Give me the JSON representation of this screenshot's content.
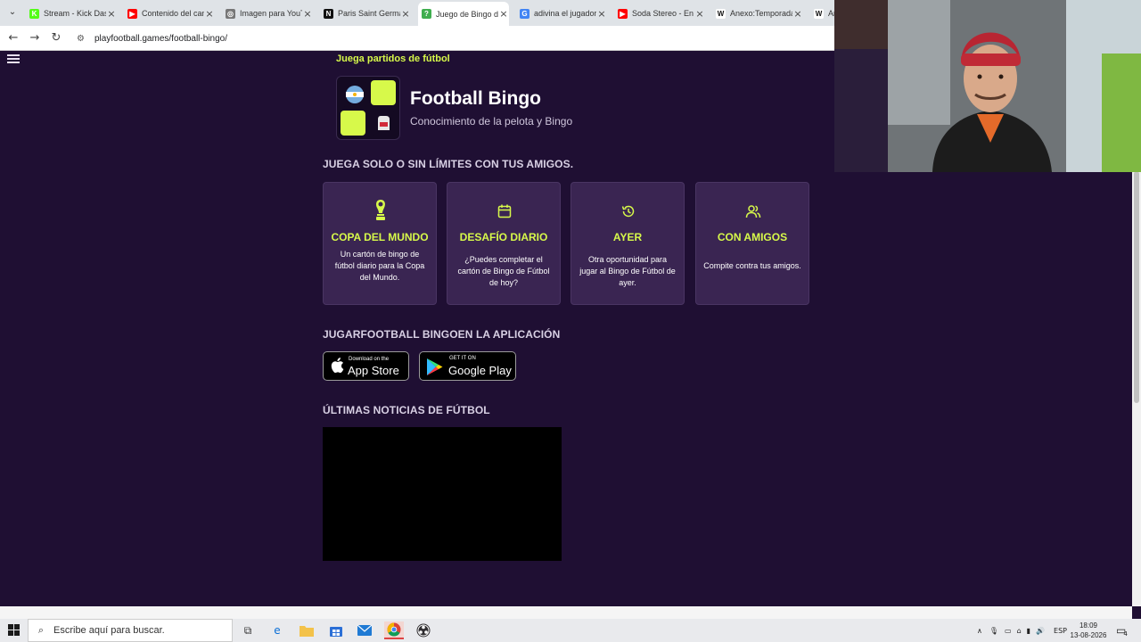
{
  "browser": {
    "tabs": [
      {
        "title": "Stream - Kick Dash",
        "icon": "kick-icon",
        "color": "#53fc18",
        "glyph": "K"
      },
      {
        "title": "Contenido del canal",
        "icon": "youtube-icon",
        "color": "#ff0000",
        "glyph": "▶"
      },
      {
        "title": "Imagen para YouTube",
        "icon": "globe-icon",
        "color": "#777777",
        "glyph": "◎"
      },
      {
        "title": "Paris Saint Germain",
        "icon": "news-icon",
        "color": "#111111",
        "glyph": "N"
      },
      {
        "title": "Juego de Bingo de",
        "icon": "bingo-icon",
        "color": "#3fae4f",
        "glyph": "?"
      },
      {
        "title": "adivina el jugador",
        "icon": "google-icon",
        "color": "#4285f4",
        "glyph": "G"
      },
      {
        "title": "Soda Stereo - En la",
        "icon": "youtube-icon",
        "color": "#ff0000",
        "glyph": "▶"
      },
      {
        "title": "Anexo:Temporada",
        "icon": "wikipedia-icon",
        "color": "#ffffff",
        "glyph": "W"
      },
      {
        "title": "An",
        "icon": "wikipedia-icon",
        "color": "#ffffff",
        "glyph": "W"
      }
    ],
    "url": "playfootball.games/football-bingo/"
  },
  "page": {
    "kicker": "Juega partidos de fútbol",
    "logo_title": "Football Bingo",
    "logo_subtitle": "Conocimiento de la pelota y Bingo",
    "modes_title": "JUEGA SOLO O SIN LÍMITES CON TUS AMIGOS.",
    "cards": [
      {
        "title": "COPA DEL MUNDO",
        "desc": "Un cartón de bingo de fútbol diario para la Copa del Mundo.",
        "icon": "trophy-icon"
      },
      {
        "title": "DESAFÍO DIARIO",
        "desc": "¿Puedes completar el cartón de Bingo de Fútbol de hoy?",
        "icon": "calendar-icon"
      },
      {
        "title": "AYER",
        "desc": "Otra oportunidad para jugar al Bingo de Fútbol de ayer.",
        "icon": "history-icon"
      },
      {
        "title": "CON AMIGOS",
        "desc": "Compite contra tus amigos.",
        "icon": "users-icon"
      }
    ],
    "app_title": "JUGARFOOTBALL BINGOEN LA APLICACIÓN",
    "app_store": {
      "small": "Download on the",
      "big": "App Store"
    },
    "google_play": {
      "small": "GET IT ON",
      "big": "Google Play"
    },
    "news_title": "ÚLTIMAS NOTICIAS DE FÚTBOL"
  },
  "colors": {
    "background": "#1f0f33",
    "accent": "#d7f94a",
    "card": "#3a2552"
  },
  "taskbar": {
    "search_placeholder": "Escribe aquí para buscar.",
    "language": "ESP",
    "time": "18:09",
    "date": "13-08-2026",
    "notification_count": "4"
  }
}
